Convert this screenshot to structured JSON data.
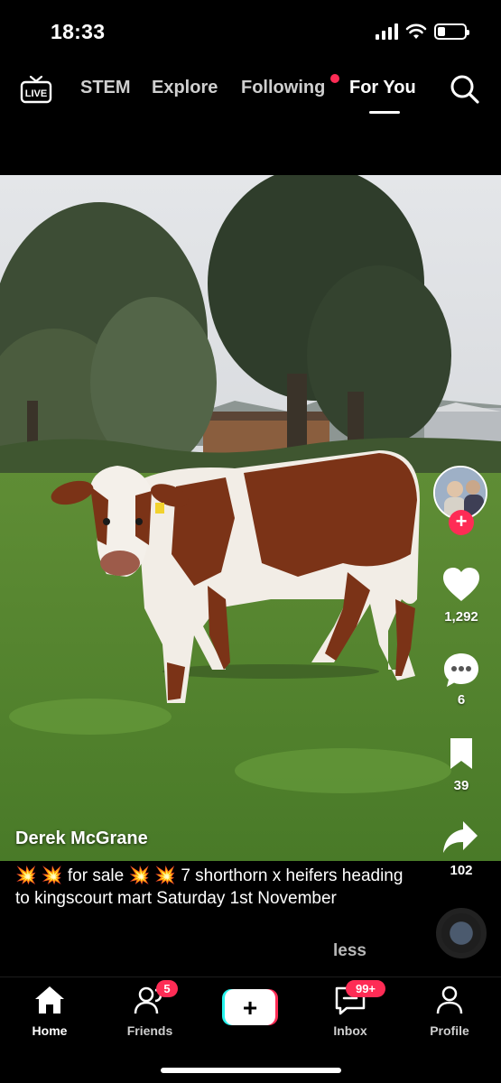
{
  "status_bar": {
    "time": "18:33",
    "battery_level": 0.3
  },
  "top_nav": {
    "live_icon": "live-tv-icon",
    "tabs": [
      {
        "label": "STEM",
        "active": false
      },
      {
        "label": "Explore",
        "active": false
      },
      {
        "label": "Following",
        "active": false,
        "has_notification_dot": true
      },
      {
        "label": "For You",
        "active": true
      }
    ],
    "search_icon": "search-icon"
  },
  "post": {
    "author": "Derek McGrane",
    "caption": "💥 💥 for sale 💥 💥 7 shorthorn x heifers heading to kingscourt mart Saturday 1st November",
    "less_label": "less",
    "follow_plus": "+"
  },
  "actions": {
    "likes": "1,292",
    "comments": "6",
    "bookmarks": "39",
    "shares": "102"
  },
  "bottom_nav": {
    "items": [
      {
        "label": "Home",
        "icon": "home-icon",
        "active": true
      },
      {
        "label": "Friends",
        "icon": "friends-icon",
        "badge": "5"
      },
      {
        "label": "",
        "icon": "create-plus-icon",
        "create_symbol": "+"
      },
      {
        "label": "Inbox",
        "icon": "inbox-icon",
        "badge": "99+"
      },
      {
        "label": "Profile",
        "icon": "profile-icon"
      }
    ]
  },
  "colors": {
    "accent": "#fe2c55",
    "background": "#000000",
    "create_cyan": "#25f4ee"
  }
}
